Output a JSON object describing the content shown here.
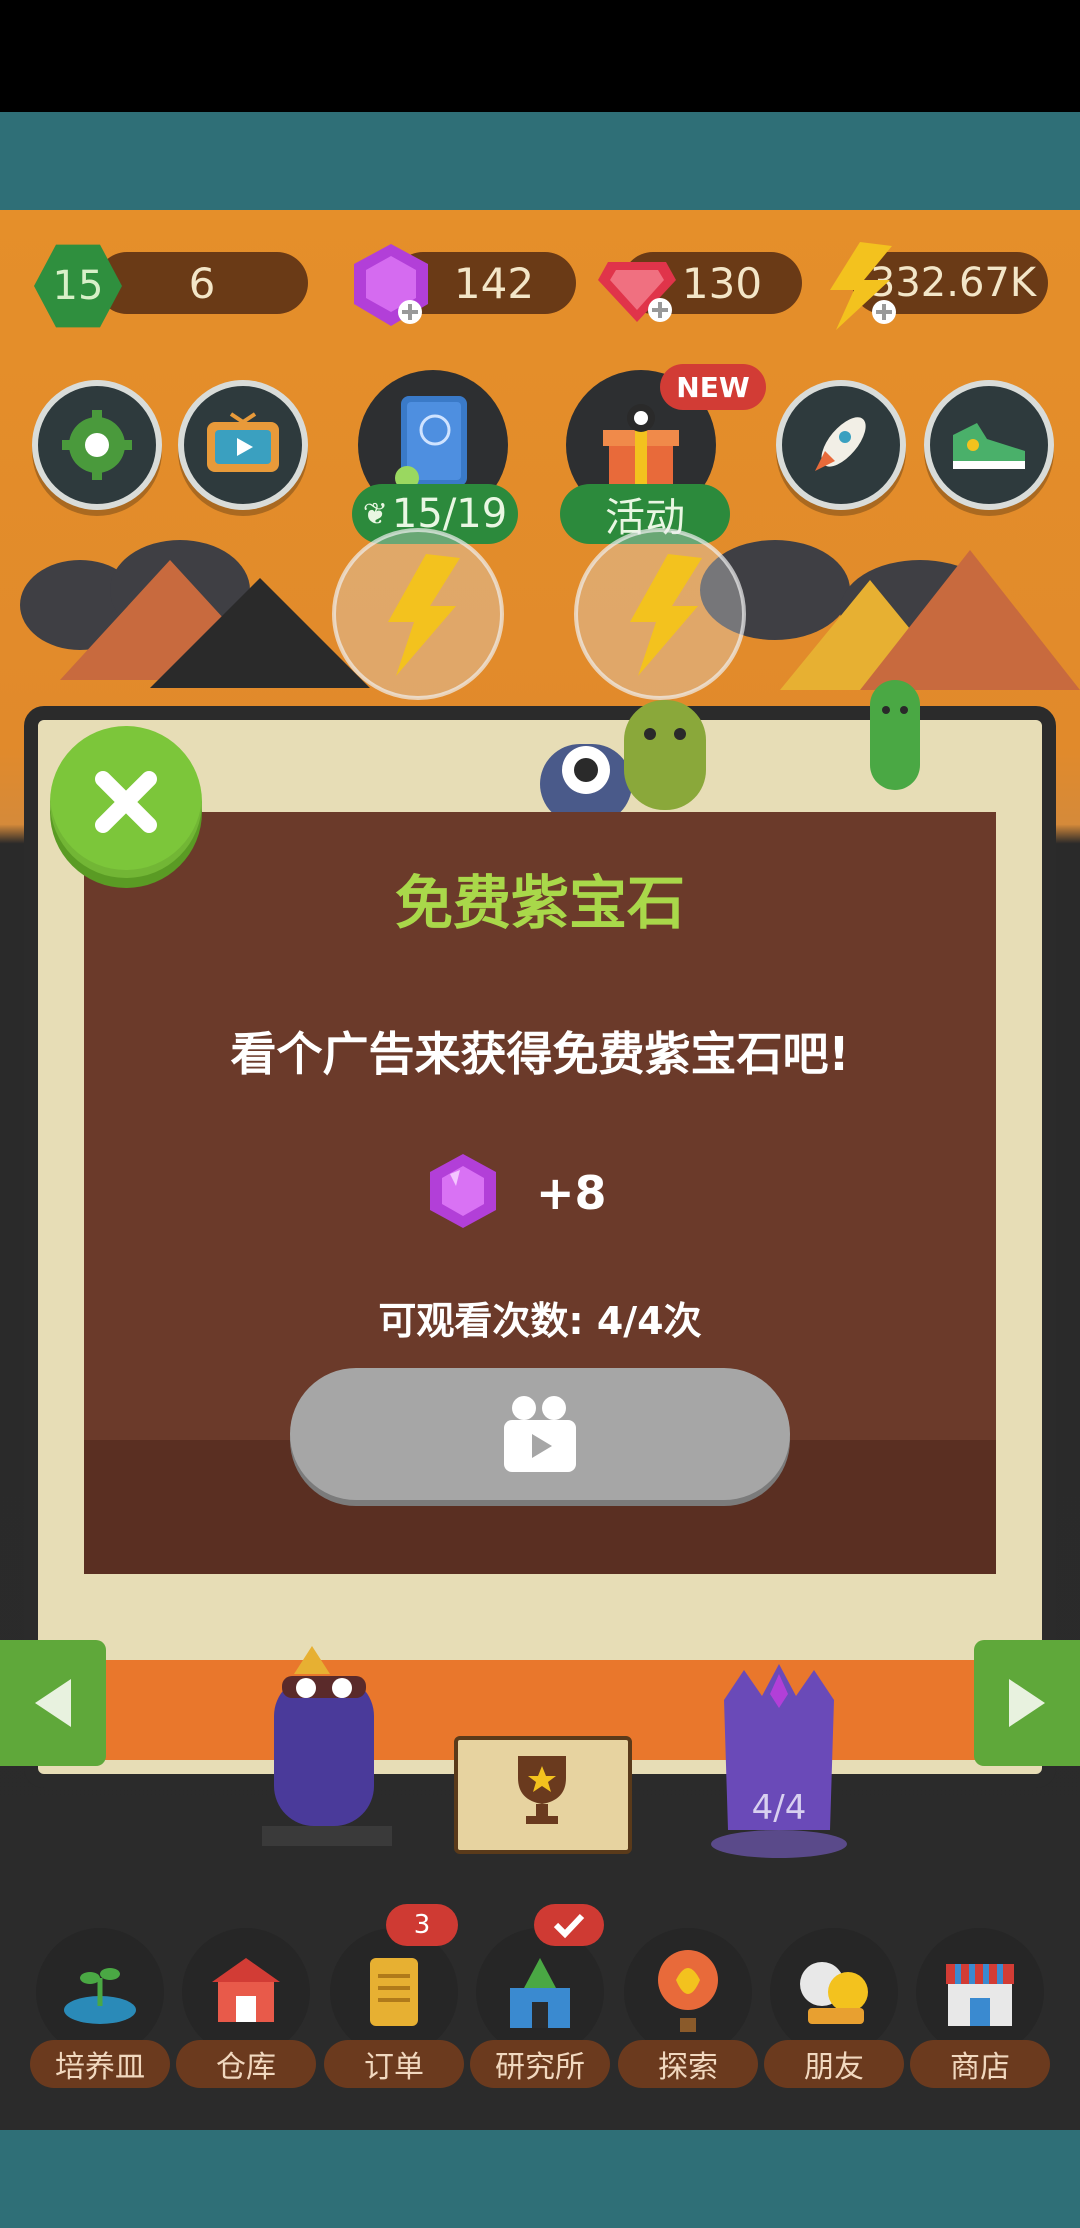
{
  "status_bar": {
    "level": "15",
    "level_progress": "6",
    "purple_gems": "142",
    "red_gems": "130",
    "energy": "332.67K"
  },
  "top_buttons": {
    "collection_count": "15/19",
    "event_label": "活动",
    "new_badge": "NEW"
  },
  "modal": {
    "title": "免费紫宝石",
    "message": "看个广告来获得免费紫宝石吧!",
    "reward_amount": "+8",
    "views_remaining": "可观看次数: 4/4次"
  },
  "board": {
    "portal_count": "4/4"
  },
  "bottom_nav": {
    "items": [
      {
        "label": "培养皿",
        "icon": "petri-dish-icon"
      },
      {
        "label": "仓库",
        "icon": "barn-icon"
      },
      {
        "label": "订单",
        "icon": "scroll-icon"
      },
      {
        "label": "研究所",
        "icon": "lab-icon"
      },
      {
        "label": "探索",
        "icon": "balloon-icon"
      },
      {
        "label": "朋友",
        "icon": "friends-icon"
      },
      {
        "label": "商店",
        "icon": "shop-icon"
      }
    ],
    "orders_badge": "3"
  },
  "colors": {
    "accent_green": "#7cc63a",
    "modal_brown": "#6b3a2a",
    "title_green": "#a9d84a",
    "purple_gem": "#b23fd8",
    "red_gem": "#e0344a",
    "energy_yellow": "#f3c21e"
  }
}
